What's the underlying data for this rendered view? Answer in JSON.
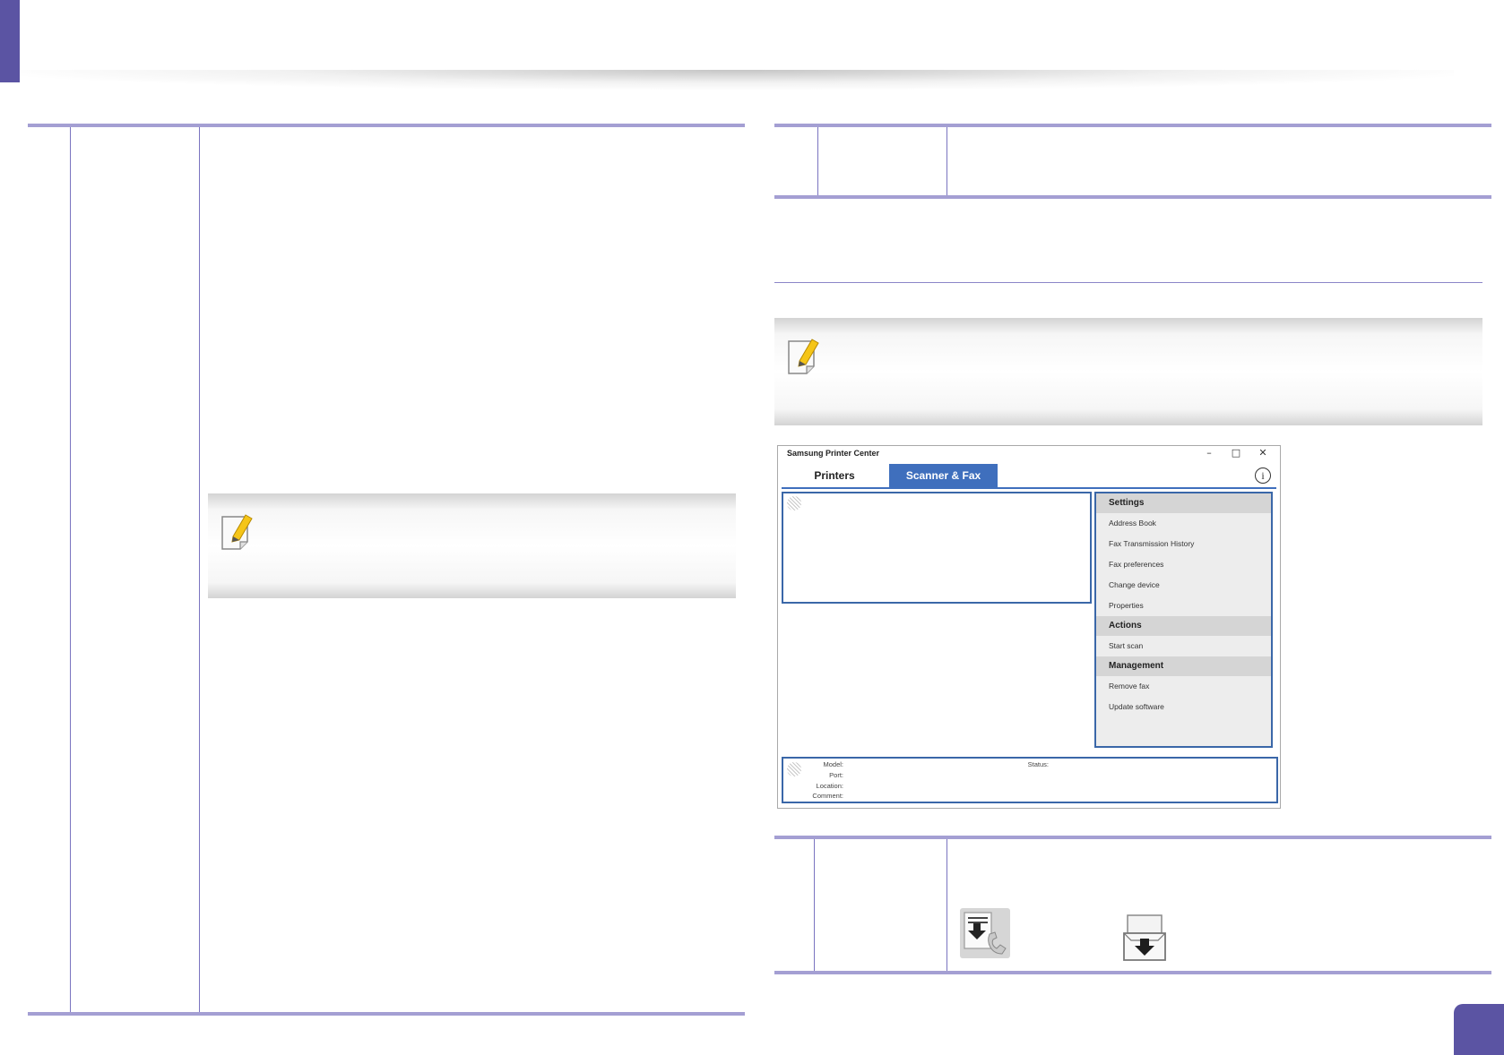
{
  "window": {
    "title": "Samsung Printer Center",
    "controls": {
      "minimize": "–",
      "maximize": "□",
      "close": "✕"
    },
    "tabs": [
      {
        "label": "Printers",
        "active": false
      },
      {
        "label": "Scanner & Fax",
        "active": true
      }
    ],
    "sidebar": {
      "sections": [
        {
          "heading": "Settings",
          "items": [
            "Address Book",
            "Fax Transmission History",
            "Fax preferences",
            "Change device",
            "Properties"
          ]
        },
        {
          "heading": "Actions",
          "items": [
            "Start scan"
          ]
        },
        {
          "heading": "Management",
          "items": [
            "Remove fax",
            "Update software"
          ]
        }
      ]
    },
    "info": {
      "model_label": "Model:",
      "port_label": "Port:",
      "location_label": "Location:",
      "comment_label": "Comment:",
      "status_label": "Status:"
    }
  },
  "colors": {
    "accent": "#5b54a3",
    "rule": "#a49fd3",
    "tab_active": "#3f6fbd",
    "panel_border": "#3a67a8"
  },
  "icons": [
    "note-pencil-icon",
    "fax-download-icon",
    "scan-download-icon",
    "info-icon"
  ]
}
